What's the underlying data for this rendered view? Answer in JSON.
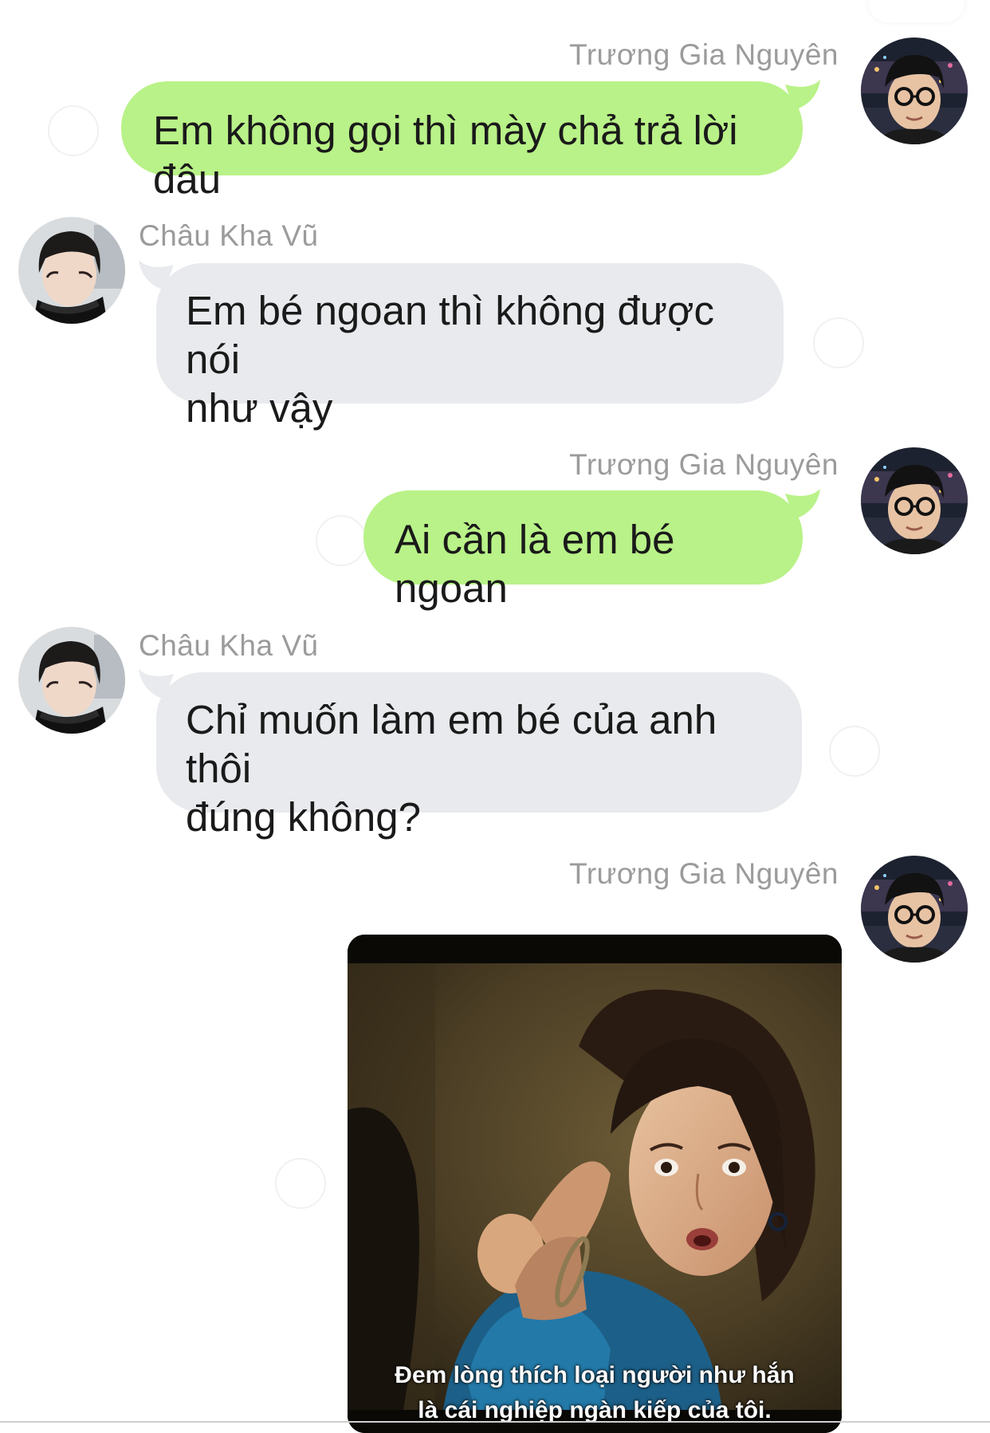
{
  "users": {
    "me": {
      "name": "Trương Gia Nguyên",
      "avatar": "avatar-glasses-man"
    },
    "them": {
      "name": "Châu Kha Vũ",
      "avatar": "avatar-masked-man"
    }
  },
  "messages": [
    {
      "sender": "Trương Gia Nguyên",
      "text": "Em không gọi thì mày chả trả lời đâu"
    },
    {
      "sender": "Châu Kha Vũ",
      "lines": [
        "Em bé ngoan thì không được nói",
        "như vậy"
      ]
    },
    {
      "sender": "Trương Gia Nguyên",
      "text": "Ai cần là em bé ngoan"
    },
    {
      "sender": "Châu Kha Vũ",
      "lines": [
        "Chỉ muốn làm em bé của anh thôi",
        "đúng không?"
      ]
    },
    {
      "sender": "Trương Gia Nguyên",
      "image": {
        "subtitle_lines": [
          "Đem lòng thích loại người như hắn",
          "là cái nghiệp ngàn kiếp của tôi."
        ]
      }
    }
  ],
  "colors": {
    "my_bubble": "#b9f288",
    "their_bubble": "#e8eaed",
    "name_text": "#9b9b9b"
  }
}
